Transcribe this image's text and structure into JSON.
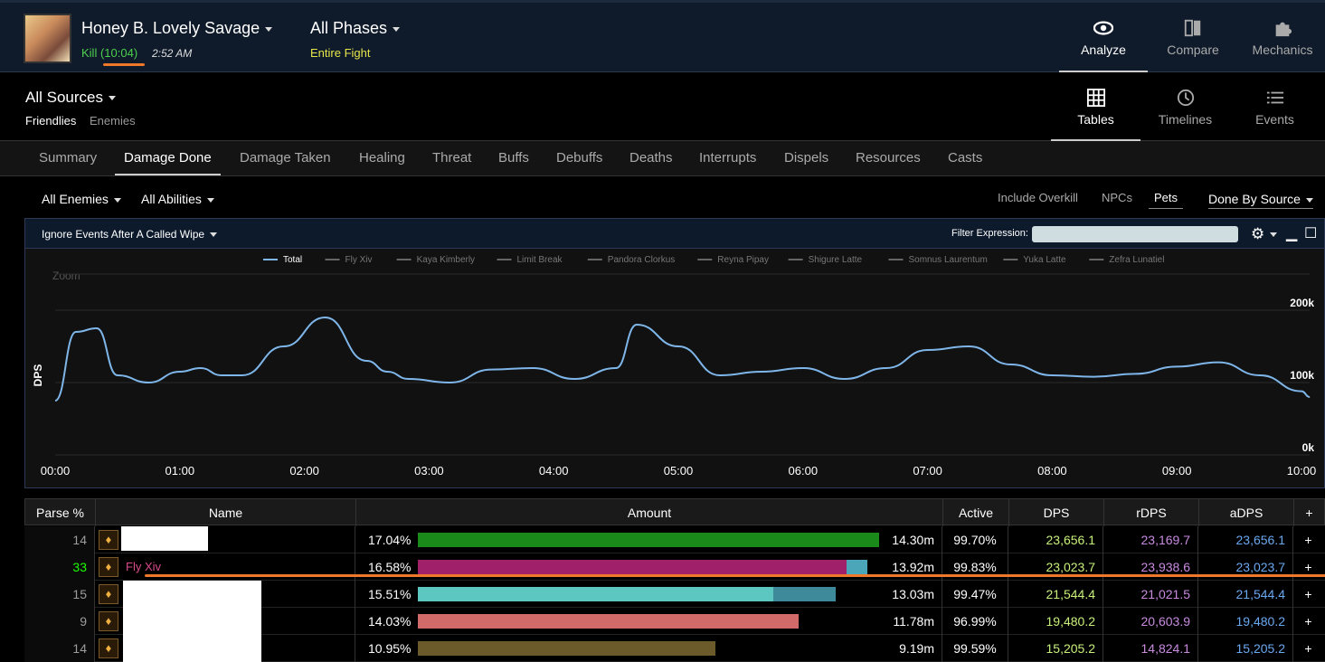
{
  "header": {
    "fight_title": "Honey B. Lovely Savage",
    "kill_label": "Kill",
    "kill_duration": "(10:04)",
    "kill_time": "2:52 AM",
    "phases": "All Phases",
    "phase_sub": "Entire Fight",
    "nav": [
      {
        "label": "Analyze",
        "icon": "eye-icon",
        "active": true
      },
      {
        "label": "Compare",
        "icon": "compare-icon"
      },
      {
        "label": "Mechanics",
        "icon": "puzzle-icon"
      }
    ]
  },
  "sources": {
    "title": "All Sources",
    "friendlies": "Friendlies",
    "enemies": "Enemies",
    "views": [
      {
        "label": "Tables",
        "icon": "grid-icon",
        "active": true
      },
      {
        "label": "Timelines",
        "icon": "clock-icon"
      },
      {
        "label": "Events",
        "icon": "list-icon"
      }
    ]
  },
  "tabs": [
    "Summary",
    "Damage Done",
    "Damage Taken",
    "Healing",
    "Threat",
    "Buffs",
    "Debuffs",
    "Deaths",
    "Interrupts",
    "Dispels",
    "Resources",
    "Casts"
  ],
  "filters": {
    "enemies": "All Enemies",
    "abilities": "All Abilities",
    "include_overkill": "Include Overkill",
    "npcs": "NPCs",
    "pets": "Pets",
    "done_by": "Done By Source"
  },
  "chart_panel": {
    "ignore_events": "Ignore Events After A Called Wipe",
    "filter_label": "Filter Expression:",
    "zoom_label": "Zoom"
  },
  "chart_data": {
    "type": "line",
    "ylabel": "DPS",
    "ylim": [
      0,
      260000
    ],
    "yticks": [
      "0k",
      "100k",
      "200k"
    ],
    "xticks": [
      "00:00",
      "01:00",
      "02:00",
      "03:00",
      "04:00",
      "05:00",
      "06:00",
      "07:00",
      "08:00",
      "09:00",
      "10:00"
    ],
    "legend": [
      "Total",
      "Fly Xiv",
      "Kaya Kimberly",
      "Limit Break",
      "Pandora Clorkus",
      "Reyna Pipay",
      "Shigure Latte",
      "Somnus Laurentum",
      "Yuka Latte",
      "Zefra Lunatiel"
    ],
    "series": [
      {
        "name": "Total",
        "color": "#7fb6ea",
        "x_seconds": [
          0,
          10,
          20,
          30,
          45,
          60,
          70,
          80,
          90,
          110,
          130,
          150,
          160,
          170,
          190,
          210,
          230,
          250,
          270,
          280,
          300,
          320,
          340,
          360,
          380,
          400,
          420,
          440,
          460,
          480,
          500,
          520,
          540,
          560,
          580,
          600,
          604
        ],
        "values": [
          75000,
          170000,
          175000,
          110000,
          100000,
          115000,
          120000,
          110000,
          110000,
          150000,
          190000,
          130000,
          115000,
          105000,
          100000,
          118000,
          120000,
          105000,
          120000,
          180000,
          150000,
          110000,
          115000,
          120000,
          105000,
          120000,
          145000,
          150000,
          125000,
          110000,
          108000,
          112000,
          122000,
          128000,
          110000,
          88000,
          80000
        ]
      }
    ]
  },
  "table": {
    "columns": [
      "Parse %",
      "Name",
      "Amount",
      "Active",
      "DPS",
      "rDPS",
      "aDPS",
      "+"
    ],
    "rows": [
      {
        "parse": "14",
        "parse_color": "#9d9d9d",
        "name": "",
        "pct": "17.04%",
        "amount": "14.30m",
        "active": "99.70%",
        "dps": "23,656.1",
        "rdps": "23,169.7",
        "adps": "23,656.1",
        "bar_color": "#1a8a1a",
        "bar_frac": 1.0,
        "bar2_color": null,
        "bar2_frac": 0,
        "icon": "job-icon"
      },
      {
        "parse": "33",
        "parse_color": "#1eff00",
        "name": "Fly Xiv",
        "name_color": "#d84a8a",
        "pct": "16.58%",
        "amount": "13.92m",
        "active": "99.83%",
        "dps": "23,023.7",
        "rdps": "23,938.6",
        "adps": "23,023.7",
        "bar_color": "#a0206a",
        "bar_frac": 0.93,
        "bar2_color": "#4aa6b8",
        "bar2_frac": 0.045,
        "icon": "job-icon"
      },
      {
        "parse": "15",
        "parse_color": "#9d9d9d",
        "name": "",
        "pct": "15.51%",
        "amount": "13.03m",
        "active": "99.47%",
        "dps": "21,544.4",
        "rdps": "21,021.5",
        "adps": "21,544.4",
        "bar_color": "#5cc7c0",
        "bar_frac": 0.77,
        "bar2_color": "#3f8a9a",
        "bar2_frac": 0.135,
        "icon": "job-icon"
      },
      {
        "parse": "9",
        "parse_color": "#9d9d9d",
        "name": "",
        "pct": "14.03%",
        "amount": "11.78m",
        "active": "96.99%",
        "dps": "19,480.2",
        "rdps": "20,603.9",
        "adps": "19,480.2",
        "bar_color": "#d26a6a",
        "bar_frac": 0.825,
        "bar2_color": null,
        "bar2_frac": 0,
        "icon": "job-icon"
      },
      {
        "parse": "14",
        "parse_color": "#9d9d9d",
        "name": "",
        "pct": "10.95%",
        "amount": "9.19m",
        "active": "99.59%",
        "dps": "15,205.2",
        "rdps": "14,824.1",
        "adps": "15,205.2",
        "bar_color": "#6b5a2a",
        "bar_frac": 0.645,
        "bar2_color": null,
        "bar2_frac": 0,
        "icon": "job-icon"
      }
    ]
  }
}
